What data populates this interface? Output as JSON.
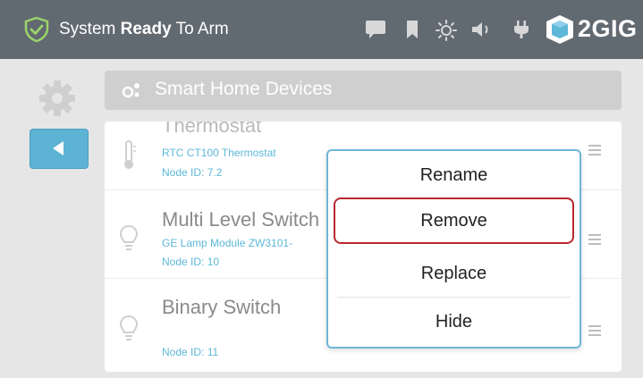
{
  "header": {
    "status_prefix": "System ",
    "status_bold": "Ready",
    "status_suffix": " To Arm",
    "status_icon": "shield-check-icon",
    "brand": "2GIG",
    "icons": [
      "message-icon",
      "bookmark-icon",
      "brightness-icon",
      "volume-icon",
      "power-plug-icon"
    ],
    "colors": {
      "bar": "#616971",
      "shield": "#9bd46a"
    }
  },
  "sidebar": {
    "settings_icon": "gear-icon",
    "back_icon": "back-arrow-icon"
  },
  "page": {
    "title": "Smart Home Devices",
    "title_icon": "devices-icon"
  },
  "devices": [
    {
      "name": "Thermostat",
      "model": "RTC CT100 Thermostat",
      "node": "Node ID: 7.2",
      "icon": "thermometer-icon"
    },
    {
      "name": "Multi Level Switch",
      "model": "GE Lamp Module ZW3101-",
      "node": "Node ID: 10",
      "icon": "lightbulb-icon"
    },
    {
      "name": "Binary Switch",
      "model": "",
      "node": "Node ID: 11",
      "icon": "lightbulb-icon"
    }
  ],
  "context_menu": {
    "items": [
      "Rename",
      "Remove",
      "Replace",
      "Hide"
    ],
    "selected": "Remove",
    "colors": {
      "border": "#6eb6d6",
      "selected_outline": "#b8282e"
    }
  }
}
